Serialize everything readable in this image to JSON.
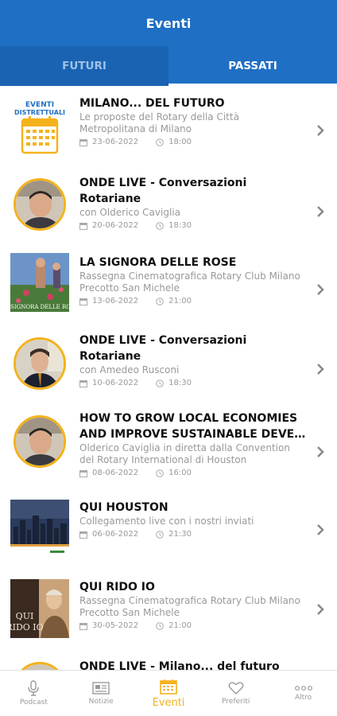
{
  "header": {
    "title": "Eventi"
  },
  "tabs": [
    {
      "label": "FUTURI",
      "active": false
    },
    {
      "label": "PASSATI",
      "active": true
    }
  ],
  "events": [
    {
      "title": "MILANO... DEL FUTURO",
      "title2": "",
      "subtitle": "Le proposte del Rotary della Città Metropolitana di Milano",
      "date": "23-06-2022",
      "time": "18:00",
      "thumb_label": "EVENTI DISTRETTUALI"
    },
    {
      "title": "ONDE LIVE - Conversazioni",
      "title2": "Rotariane",
      "subtitle": "con Olderico Caviglia",
      "date": "20-06-2022",
      "time": "18:30"
    },
    {
      "title": "LA SIGNORA DELLE ROSE",
      "title2": "",
      "subtitle": "Rassegna Cinematografica Rotary Club Milano Precotto San Michele",
      "date": "13-06-2022",
      "time": "21:00"
    },
    {
      "title": "ONDE LIVE - Conversazioni",
      "title2": "Rotariane",
      "subtitle": "con Amedeo Rusconi",
      "date": "10-06-2022",
      "time": "18:30"
    },
    {
      "title": "HOW TO GROW LOCAL ECONOMIES",
      "title2": "AND IMPROVE SUSTAINABLE DEVE...",
      "subtitle": "Olderico Caviglia in diretta dalla Convention del Rotary International di Houston",
      "date": "08-06-2022",
      "time": "16:00"
    },
    {
      "title": "QUI HOUSTON",
      "title2": "",
      "subtitle": "Collegamento live con i nostri inviati",
      "date": "06-06-2022",
      "time": "21:30"
    },
    {
      "title": "QUI RIDO IO",
      "title2": "",
      "subtitle": "Rassegna Cinematografica Rotary Club Milano Precotto San Michele",
      "date": "30-05-2022",
      "time": "21:00"
    },
    {
      "title": "ONDE LIVE - Milano... del futuro",
      "title2": "",
      "subtitle": "",
      "date": "",
      "time": ""
    }
  ],
  "bottom_nav": [
    {
      "label": "Podcast",
      "icon": "microphone-icon"
    },
    {
      "label": "Notizie",
      "icon": "news-icon"
    },
    {
      "label": "Eventi",
      "icon": "calendar-icon",
      "active": true
    },
    {
      "label": "Preferiti",
      "icon": "heart-icon"
    },
    {
      "label": "Altro",
      "icon": "more-icon"
    }
  ],
  "colors": {
    "primary": "#1f6fc4",
    "accent": "#f3b21c"
  }
}
